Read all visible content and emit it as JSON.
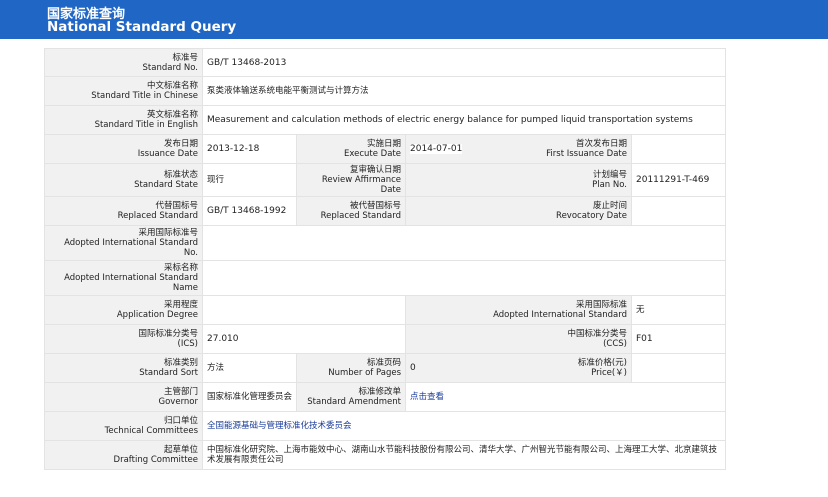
{
  "header": {
    "title_cn": "国家标准查询",
    "title_en": "National Standard Query"
  },
  "fields": {
    "standard_no": {
      "label_cn": "标准号",
      "label_en": "Standard No.",
      "value": "GB/T 13468-2013"
    },
    "title_chinese": {
      "label_cn": "中文标准名称",
      "label_en": "Standard Title in Chinese",
      "value": "泵类液体输送系统电能平衡测试与计算方法"
    },
    "title_english": {
      "label_cn": "英文标准名称",
      "label_en": "Standard Title in English",
      "value": "Measurement and calculation methods of electric energy balance for pumped liquid transportation systems"
    },
    "issuance_date": {
      "label_cn": "发布日期",
      "label_en": "Issuance Date",
      "value": "2013-12-18"
    },
    "execute_date": {
      "label_cn": "实施日期",
      "label_en": "Execute Date",
      "value": "2014-07-01"
    },
    "first_issuance_date": {
      "label_cn": "首次发布日期",
      "label_en": "First Issuance Date",
      "value": ""
    },
    "standard_state": {
      "label_cn": "标准状态",
      "label_en": "Standard State",
      "value": "现行"
    },
    "review_affirmance_date": {
      "label_cn": "复审确认日期",
      "label_en": "Review Affirmance Date",
      "value": ""
    },
    "plan_no": {
      "label_cn": "计划编号",
      "label_en": "Plan No.",
      "value": "20111291-T-469"
    },
    "replaced_standard": {
      "label_cn": "代替国标号",
      "label_en": "Replaced Standard",
      "value": "GB/T 13468-1992"
    },
    "replaced_by": {
      "label_cn": "被代替国标号",
      "label_en": "Replaced Standard",
      "value": ""
    },
    "revocatory_date": {
      "label_cn": "废止时间",
      "label_en": "Revocatory Date",
      "value": ""
    },
    "adopted_intl_no": {
      "label_cn": "采用国际标准号",
      "label_en": "Adopted International Standard No.",
      "value": ""
    },
    "adopted_intl_name": {
      "label_cn": "采标名称",
      "label_en": "Adopted International Standard Name",
      "value": ""
    },
    "application_degree": {
      "label_cn": "采用程度",
      "label_en": "Application Degree",
      "value": ""
    },
    "adopted_intl": {
      "label_cn": "采用国际标准",
      "label_en": "Adopted International Standard",
      "value": "无"
    },
    "ics": {
      "label_cn": "国际标准分类号",
      "label_en": "(ICS)",
      "value": "27.010"
    },
    "ccs": {
      "label_cn": "中国标准分类号",
      "label_en": "(CCS)",
      "value": "F01"
    },
    "standard_sort": {
      "label_cn": "标准类别",
      "label_en": "Standard Sort",
      "value": "方法"
    },
    "number_of_pages": {
      "label_cn": "标准页码",
      "label_en": "Number of Pages",
      "value": "0"
    },
    "price": {
      "label_cn": "标准价格(元)",
      "label_en": "Price(￥)",
      "value": ""
    },
    "governor": {
      "label_cn": "主管部门",
      "label_en": "Governor",
      "value": "国家标准化管理委员会"
    },
    "standard_amendment": {
      "label_cn": "标准修改单",
      "label_en": "Standard Amendment",
      "value": "点击查看"
    },
    "technical_committees": {
      "label_cn": "归口单位",
      "label_en": "Technical Committees",
      "value": "全国能源基础与管理标准化技术委员会"
    },
    "drafting_committee": {
      "label_cn": "起草单位",
      "label_en": "Drafting Committee",
      "value": "中国标准化研究院、上海市能效中心、湖南山水节能科技股份有限公司、清华大学、广州智光节能有限公司、上海理工大学、北京建筑技术发展有限责任公司"
    }
  },
  "colors": {
    "header_bg": "#1f66c5",
    "label_bg": "#f1f1f1",
    "link": "#1a3b9a"
  }
}
